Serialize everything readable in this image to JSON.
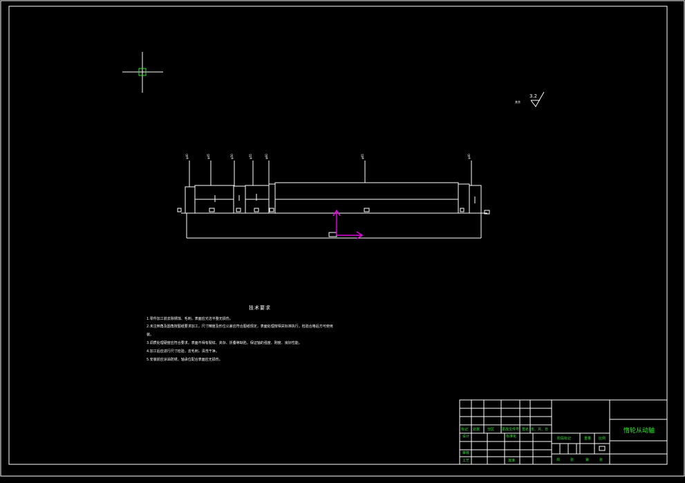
{
  "drawing": {
    "part_name": "惰轮从动轴",
    "roughness": {
      "value": "3.2",
      "prefix": "其余"
    },
    "tech_title": "技术要求",
    "tech_notes": [
      "1.零件加工前去除锈蚀、毛刺，表面应光洁平整无损伤。",
      "2.未注倒角及圆角按图纸要求加工，尺寸精度及形位公差应符合图纸规定，表面处理按相关标准执行，检验合格后方可使用",
      "  装。",
      "3.调质处理硬度应符合要求，表面不得有裂纹、夹杂、折叠等缺陷，保证轴的强度、刚度、良好性能。",
      "4.加工后应进行尺寸检验，去毛刺，清洗干净。",
      "5.安装前应涂油防锈，轴承位配合表面应无损伤。"
    ],
    "shaft_dims": [
      "φ40",
      "φ45",
      "φ50",
      "φ55",
      "φ60",
      "φ65",
      "φ40"
    ],
    "title_block": {
      "row_labels": [
        "标记",
        "处数",
        "分区",
        "更改文件号",
        "签名",
        "年、月、日"
      ],
      "left_labels": [
        "设计",
        "审核",
        "工艺"
      ],
      "mid_labels": [
        "标准化",
        "批准"
      ],
      "stage_labels": [
        "阶段标记",
        "重量",
        "比例"
      ],
      "sheet_labels": [
        "共",
        "张",
        "第",
        "张"
      ]
    }
  }
}
